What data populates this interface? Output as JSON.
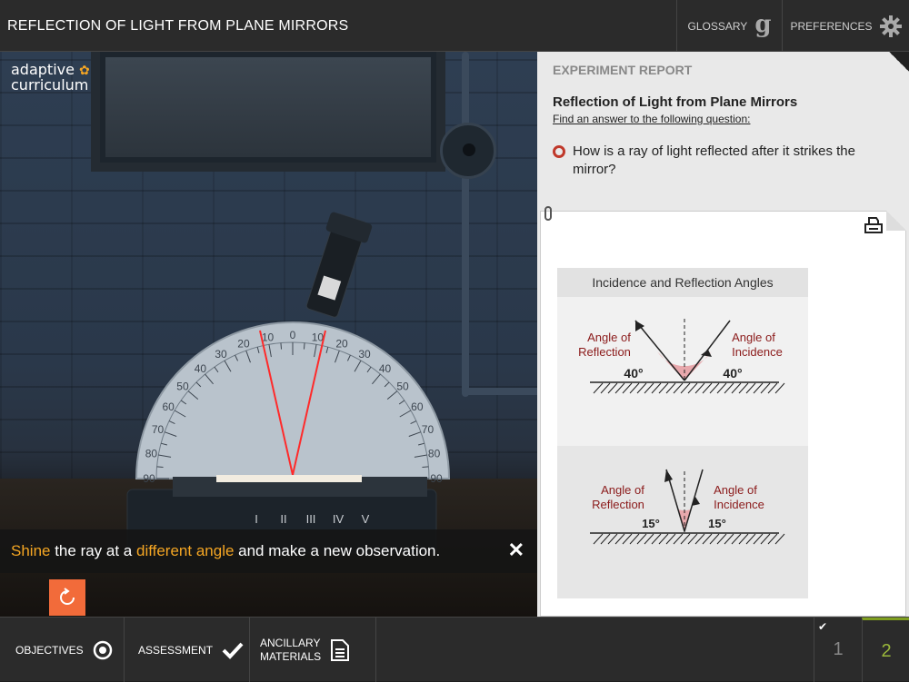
{
  "header": {
    "title": "REFLECTION OF LIGHT FROM PLANE MIRRORS",
    "glossary_label": "GLOSSARY",
    "glossary_icon": "g",
    "preferences_label": "PREFERENCES"
  },
  "scene": {
    "logo_line1": "adaptive",
    "logo_line2": "curriculum",
    "scale_labels": [
      "10",
      "0",
      "10",
      "20",
      "30",
      "40",
      "50",
      "60",
      "70",
      "80",
      "90",
      "20",
      "30",
      "40",
      "50",
      "60",
      "70",
      "80",
      "90"
    ],
    "roman_labels": [
      "I",
      "II",
      "III",
      "IV",
      "V"
    ]
  },
  "instruction": {
    "part1": "Shine",
    "part2": " the ray at a ",
    "part3": "different angle",
    "part4": " and make a new observation."
  },
  "report": {
    "heading": "EXPERIMENT REPORT",
    "title": "Reflection of Light from Plane Mirrors",
    "subtitle": "Find an answer to the following question:",
    "question": "How is a ray of light reflected after it strikes the mirror?"
  },
  "diagram": {
    "title": "Incidence and Reflection Angles",
    "top": {
      "reflection_label_1": "Angle of",
      "reflection_label_2": "Reflection",
      "incidence_label_1": "Angle of",
      "incidence_label_2": "Incidence",
      "left_angle": "40°",
      "right_angle": "40°"
    },
    "bottom": {
      "reflection_label_1": "Angle of",
      "reflection_label_2": "Reflection",
      "incidence_label_1": "Angle of",
      "incidence_label_2": "Incidence",
      "left_angle": "15°",
      "right_angle": "15°"
    }
  },
  "footer": {
    "objectives_label": "OBJECTIVES",
    "assessment_label": "ASSESSMENT",
    "ancillary_line1": "ANCILLARY",
    "ancillary_line2": "MATERIALS",
    "page1": "1",
    "page2": "2",
    "accent_color": "#7f9f1f"
  }
}
